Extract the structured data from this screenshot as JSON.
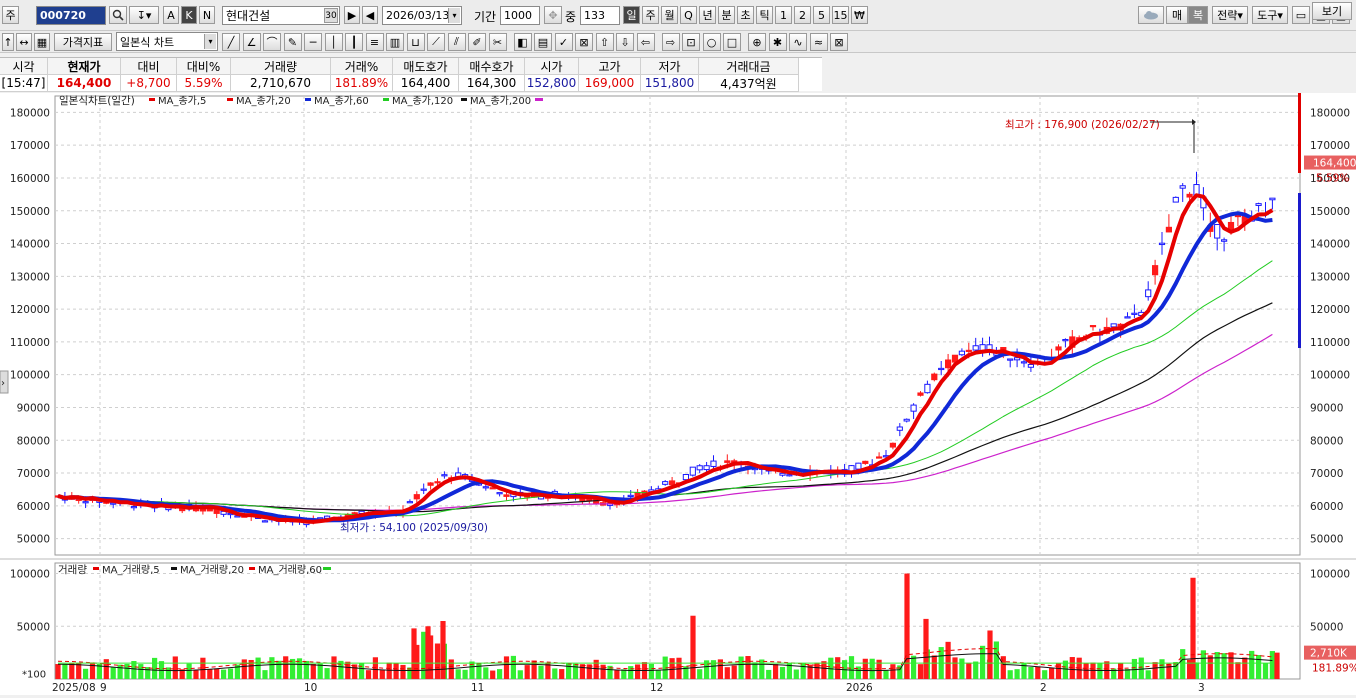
{
  "toolbar": {
    "prefix": "주",
    "code": "000720",
    "name": "현대건설",
    "name_num": "30",
    "date": "2026/03/13",
    "period_label": "기간",
    "period_value": "1000",
    "middle_label": "중",
    "middle_value": "133",
    "btn_a": "A",
    "btn_k": "K",
    "btn_n": "N",
    "tf": [
      "일",
      "주",
      "월",
      "Q",
      "년",
      "분",
      "초",
      "틱",
      "1",
      "2",
      "5",
      "15"
    ],
    "won": "₩",
    "right": [
      "매",
      "복",
      "전략",
      "도구"
    ],
    "indicator_btn": "가격지표",
    "charttype": "일본식 차트",
    "view_btn": "보기"
  },
  "quote": {
    "headers": [
      "시각",
      "현재가",
      "대비",
      "대비%",
      "거래량",
      "거래%",
      "매도호가",
      "매수호가",
      "시가",
      "고가",
      "저가",
      "거래대금"
    ],
    "values": [
      "[15:47]",
      "164,400",
      "+8,700",
      "5.59%",
      "2,710,670",
      "181.89%",
      "164,400",
      "164,300",
      "152,800",
      "169,000",
      "151,800",
      "4,437억원"
    ]
  },
  "chart": {
    "legend_title": "일본식차트(일간)",
    "legend_items": [
      {
        "label": "MA_종가,5",
        "color": "#e60000"
      },
      {
        "label": "MA_종가,20",
        "color": "#e60000"
      },
      {
        "label": "MA_종가,60",
        "color": "#1028d8"
      },
      {
        "label": "MA_종가,120",
        "color": "#22cc22"
      },
      {
        "label": "MA_종가,200",
        "color": "#111111"
      }
    ],
    "price_ticks": [
      "180000",
      "170000",
      "160000",
      "150000",
      "140000",
      "130000",
      "120000",
      "110000",
      "100000",
      "90000",
      "80000",
      "70000",
      "60000",
      "50000"
    ],
    "high_note": "최고가 : 176,900 (2026/02/27)",
    "low_note": "최저가 : 54,100 (2025/09/30)",
    "last_price": "164,400",
    "last_pct": "5.59%",
    "vol_legend_title": "거래량",
    "vol_legend_items": [
      {
        "label": "MA_거래량,5",
        "color": "#e60000"
      },
      {
        "label": "MA_거래량,20",
        "color": "#111111"
      },
      {
        "label": "MA_거래량,60",
        "color": "#e60000"
      }
    ],
    "vol_ticks": [
      "100000",
      "50000"
    ],
    "vol_unit": "*100",
    "vol_last": "2,710K",
    "vol_pct": "181.89%",
    "x_labels": [
      "2025/08",
      "9",
      "10",
      "11",
      "12",
      "2026",
      "2",
      "3"
    ],
    "colors": {
      "up": "#ff1a1a",
      "down": "#1a1aff",
      "vol_up": "#ff1a1a",
      "vol_down": "#33ee33",
      "ma5": "#e60000",
      "ma20": "#e60000",
      "ma60": "#1028d8",
      "ma120": "#22cc22",
      "ma200": "#111111",
      "ma_pink": "#cc22cc"
    }
  },
  "chart_data": {
    "type": "line",
    "title": "일본식차트(일간)",
    "x": [
      "2025/08",
      "2025/09",
      "2025/10",
      "2025/11",
      "2025/12",
      "2026/01",
      "2026/02",
      "2026/03"
    ],
    "ylim": [
      45000,
      185000
    ],
    "series": [
      {
        "name": "MA_종가,5",
        "values": [
          62000,
          59500,
          55500,
          68000,
          63000,
          71000,
          108000,
          155000
        ]
      },
      {
        "name": "MA_종가,20",
        "values": [
          62500,
          60000,
          56500,
          64000,
          63500,
          70500,
          104000,
          147000
        ]
      },
      {
        "name": "MA_종가,60",
        "values": [
          64000,
          61000,
          57000,
          63000,
          64000,
          70000,
          96000,
          144000
        ]
      },
      {
        "name": "MA_종가,120",
        "values": [
          68000,
          64000,
          60000,
          62000,
          64500,
          69000,
          85000,
          118000
        ]
      },
      {
        "name": "MA_종가,200",
        "values": [
          61000,
          60500,
          59500,
          61000,
          62500,
          66000,
          76000,
          99000
        ]
      }
    ],
    "annotations": [
      "최고가 : 176,900 (2026/02/27)",
      "최저가 : 54,100 (2025/09/30)"
    ],
    "volume": {
      "name": "거래량",
      "ylim": [
        0,
        100000
      ],
      "unit": "*100",
      "last": "2,710K"
    },
    "grid": true,
    "legend": "top-left"
  }
}
